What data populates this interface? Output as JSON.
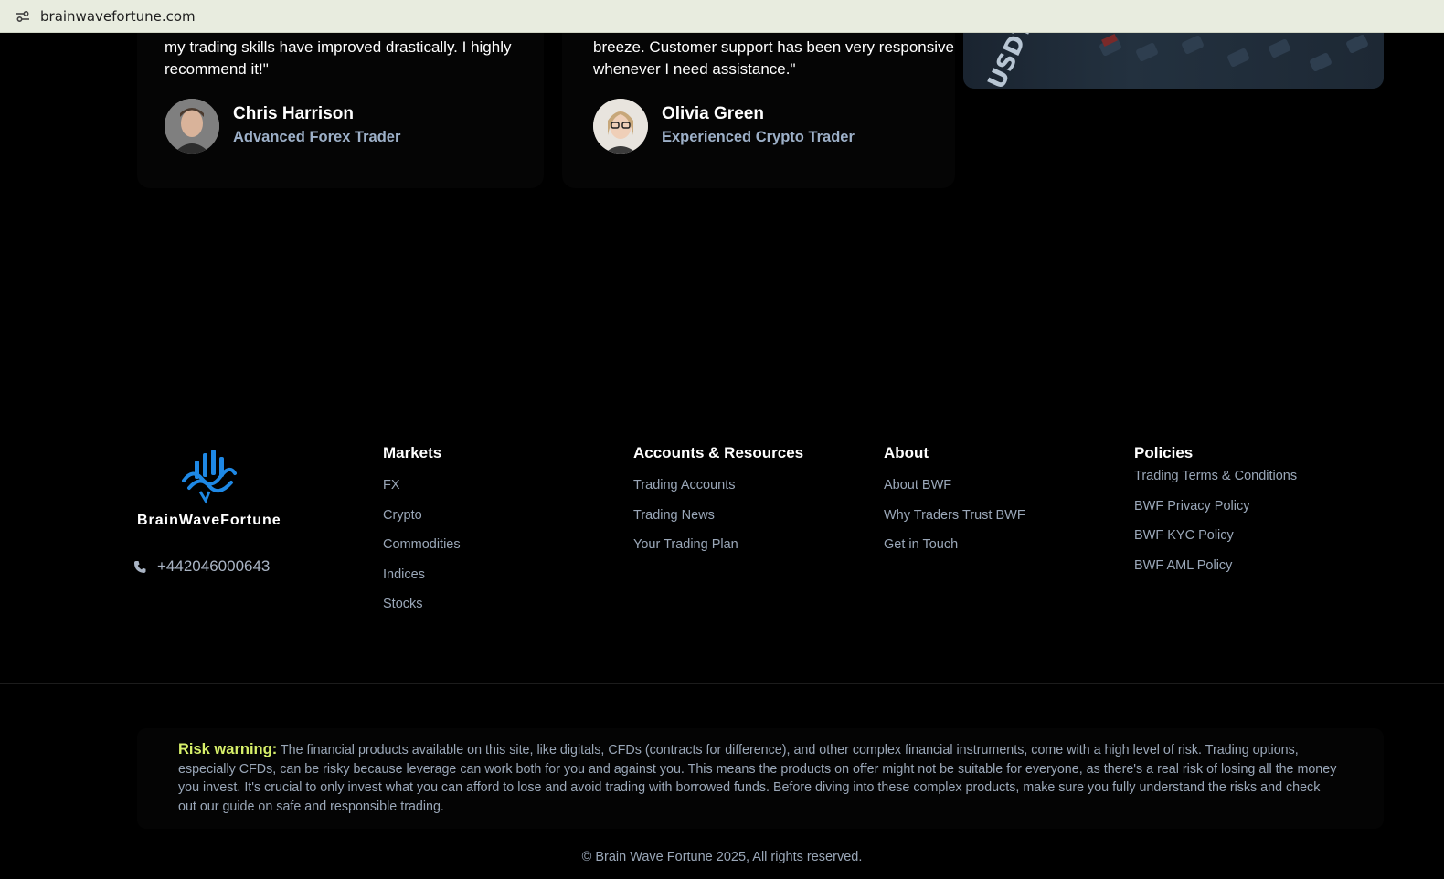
{
  "browser": {
    "url": "brainwavefortune.com"
  },
  "testimonials": [
    {
      "quote": "my trading skills have improved drastically. I highly recommend it!\"",
      "name": "Chris Harrison",
      "role": "Advanced Forex Trader"
    },
    {
      "quote": "breeze. Customer support has been very responsive whenever I need assistance.\"",
      "name": "Olivia Green",
      "role": "Experienced Crypto Trader"
    }
  ],
  "footer": {
    "logo_text": "BrainWaveFortune",
    "phone": "+442046000643",
    "markets": {
      "title": "Markets",
      "links": [
        "FX",
        "Crypto",
        "Commodities",
        "Indices",
        "Stocks"
      ]
    },
    "accounts": {
      "title": "Accounts & Resources",
      "links": [
        "Trading Accounts",
        "Trading News",
        "Your Trading Plan"
      ]
    },
    "about": {
      "title": "About",
      "links": [
        "About BWF",
        "Why Traders Trust BWF",
        "Get in Touch"
      ]
    },
    "policies": {
      "title": "Policies",
      "links": [
        "Trading Terms & Conditions",
        "BWF Privacy Policy",
        "BWF KYC Policy",
        "BWF AML Policy"
      ]
    },
    "risk_label": "Risk warning:",
    "risk_text": "The financial products available on this site, like digitals, CFDs (contracts for difference), and other complex financial instruments, come with a high level of risk. Trading options, especially CFDs, can be risky because leverage can work both for you and against you. This means the products on offer might not be suitable for everyone, as there's a real risk of losing all the money you invest. It's crucial to only invest what you can afford to lose and avoid trading with borrowed funds. Before diving into these complex products, make sure you fully understand the risks and check out our guide on safe and responsible trading.",
    "copyright": "© Brain Wave Fortune 2025, All rights reserved."
  },
  "hero_image": {
    "watermark": "USDT"
  },
  "colors": {
    "accent_green": "#d7f06a",
    "link_gray": "#9aa7b8",
    "logo_blue": "#1e88e5"
  }
}
